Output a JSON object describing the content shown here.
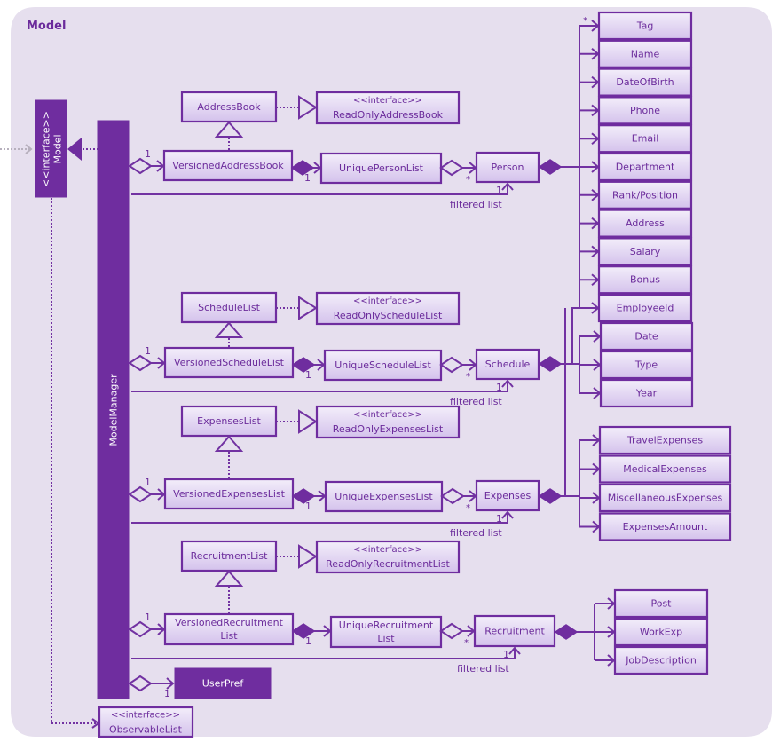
{
  "package": {
    "title": "Model"
  },
  "interfaces": {
    "model": {
      "stereotype": "<<interface>>",
      "name": "Model"
    },
    "observable_list": {
      "stereotype": "<<interface>>",
      "name": "ObservableList"
    }
  },
  "model_manager": {
    "name": "ModelManager"
  },
  "user_pref": {
    "name": "UserPref",
    "multiplicity": "1"
  },
  "rows": [
    {
      "id": "addressbook",
      "base": "AddressBook",
      "readonly": {
        "stereotype": "<<interface>>",
        "name": "ReadOnlyAddressBook"
      },
      "versioned": [
        "VersionedAddressBook"
      ],
      "unique": [
        "UniquePersonList"
      ],
      "entity": "Person",
      "mult_versioned": "1",
      "mult_unique": "1",
      "mult_entity": "*",
      "mult_filtered": "1",
      "filtered_label": "filtered list"
    },
    {
      "id": "schedule",
      "base": "ScheduleList",
      "readonly": {
        "stereotype": "<<interface>>",
        "name": "ReadOnlyScheduleList"
      },
      "versioned": [
        "VersionedScheduleList"
      ],
      "unique": [
        "UniqueScheduleList"
      ],
      "entity": "Schedule",
      "mult_versioned": "1",
      "mult_unique": "1",
      "mult_entity": "*",
      "mult_filtered": "1",
      "filtered_label": "filtered list"
    },
    {
      "id": "expenses",
      "base": "ExpensesList",
      "readonly": {
        "stereotype": "<<interface>>",
        "name": "ReadOnlyExpensesList"
      },
      "versioned": [
        "VersionedExpensesList"
      ],
      "unique": [
        "UniqueExpensesList"
      ],
      "entity": "Expenses",
      "mult_versioned": "1",
      "mult_unique": "1",
      "mult_entity": "*",
      "mult_filtered": "1",
      "filtered_label": "filtered list"
    },
    {
      "id": "recruitment",
      "base": "RecruitmentList",
      "readonly": {
        "stereotype": "<<interface>>",
        "name": "ReadOnlyRecruitmentList"
      },
      "versioned": [
        "VersionedRecruitment",
        "List"
      ],
      "unique": [
        "UniqueRecruitment",
        "List"
      ],
      "entity": "Recruitment",
      "mult_versioned": "1",
      "mult_unique": "1",
      "mult_entity": "*",
      "mult_filtered": "1",
      "filtered_label": "filtered list"
    }
  ],
  "person_attributes": {
    "multiplicity": "*",
    "items": [
      "Tag",
      "Name",
      "DateOfBirth",
      "Phone",
      "Email",
      "Department",
      "Rank/Position",
      "Address",
      "Salary",
      "Bonus",
      "EmployeeId"
    ]
  },
  "schedule_attributes": [
    "Date",
    "Type",
    "Year"
  ],
  "expenses_attributes": [
    "TravelExpenses",
    "MedicalExpenses",
    "MiscellaneousExpenses",
    "ExpensesAmount"
  ],
  "recruitment_attributes": [
    "Post",
    "WorkExp",
    "JobDescription"
  ],
  "colors": {
    "accent": "#6f2d9f",
    "package_bg": "#e6dfee",
    "class_fill_top": "#f3eefa",
    "class_fill_bottom": "#d3c0ec",
    "text": "#6b2b9b"
  }
}
